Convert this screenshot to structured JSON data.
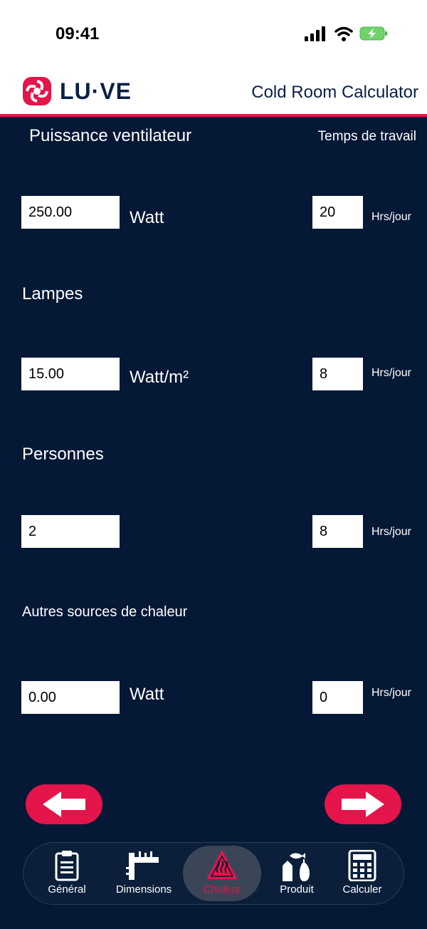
{
  "status": {
    "time": "09:41"
  },
  "header": {
    "brand": "LU·VE",
    "title": "Cold Room Calculator"
  },
  "sections": {
    "fan_power_label": "Puissance ventilateur",
    "work_time_label": "Temps de travail",
    "fan_value": "250.00",
    "fan_unit": "Watt",
    "fan_hours": "20",
    "lamps_label": "Lampes",
    "lamps_value": "15.00",
    "lamps_unit": "Watt/m²",
    "lamps_hours": "8",
    "persons_label": "Personnes",
    "persons_value": "2",
    "persons_hours": "8",
    "other_label": "Autres sources de chaleur",
    "other_value": "0.00",
    "other_unit": "Watt",
    "other_hours": "0",
    "hours_unit": "Hrs/jour"
  },
  "tabs": [
    {
      "label": "Général",
      "icon": "clipboard-icon"
    },
    {
      "label": "Dimensions",
      "icon": "ruler-icon"
    },
    {
      "label": "Chaleur",
      "icon": "heat-warning-icon"
    },
    {
      "label": "Produit",
      "icon": "food-product-icon"
    },
    {
      "label": "Calculer",
      "icon": "calculator-icon"
    }
  ],
  "colors": {
    "accent": "#e3154a",
    "background": "#051836",
    "header_text": "#0a1f44"
  }
}
